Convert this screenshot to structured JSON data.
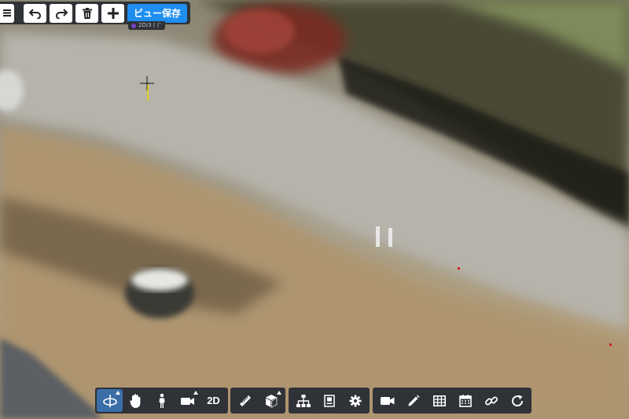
{
  "top_toolbar": {
    "menu_icon": "menu-icon",
    "undo_icon": "undo-icon",
    "redo_icon": "redo-icon",
    "trash_icon": "trash-icon",
    "add_icon": "plus-icon",
    "save_view_label": "ビュー保存",
    "accent_color": "#1e8ef0",
    "coord_readout": "2D/3 ( ('"
  },
  "bottom_toolbar": {
    "navigation": [
      {
        "icon": "orbit-icon",
        "active": true,
        "has_menu": true
      },
      {
        "icon": "hand-pan-icon"
      },
      {
        "icon": "person-walk-icon"
      },
      {
        "icon": "camera-icon",
        "has_menu": true
      },
      {
        "label": "2D"
      }
    ],
    "measure": [
      {
        "icon": "ruler-icon"
      },
      {
        "icon": "box-3d-icon",
        "has_menu": true
      }
    ],
    "structure": [
      {
        "icon": "hierarchy-icon"
      },
      {
        "icon": "panel-icon"
      },
      {
        "icon": "gear-icon"
      }
    ],
    "tools": [
      {
        "icon": "video-camera-icon"
      },
      {
        "icon": "pencil-icon"
      },
      {
        "icon": "grid-table-icon"
      },
      {
        "icon": "calendar-icon"
      },
      {
        "icon": "link-icon"
      },
      {
        "icon": "refresh-icon"
      }
    ],
    "active_color": "#3b6ea8"
  }
}
